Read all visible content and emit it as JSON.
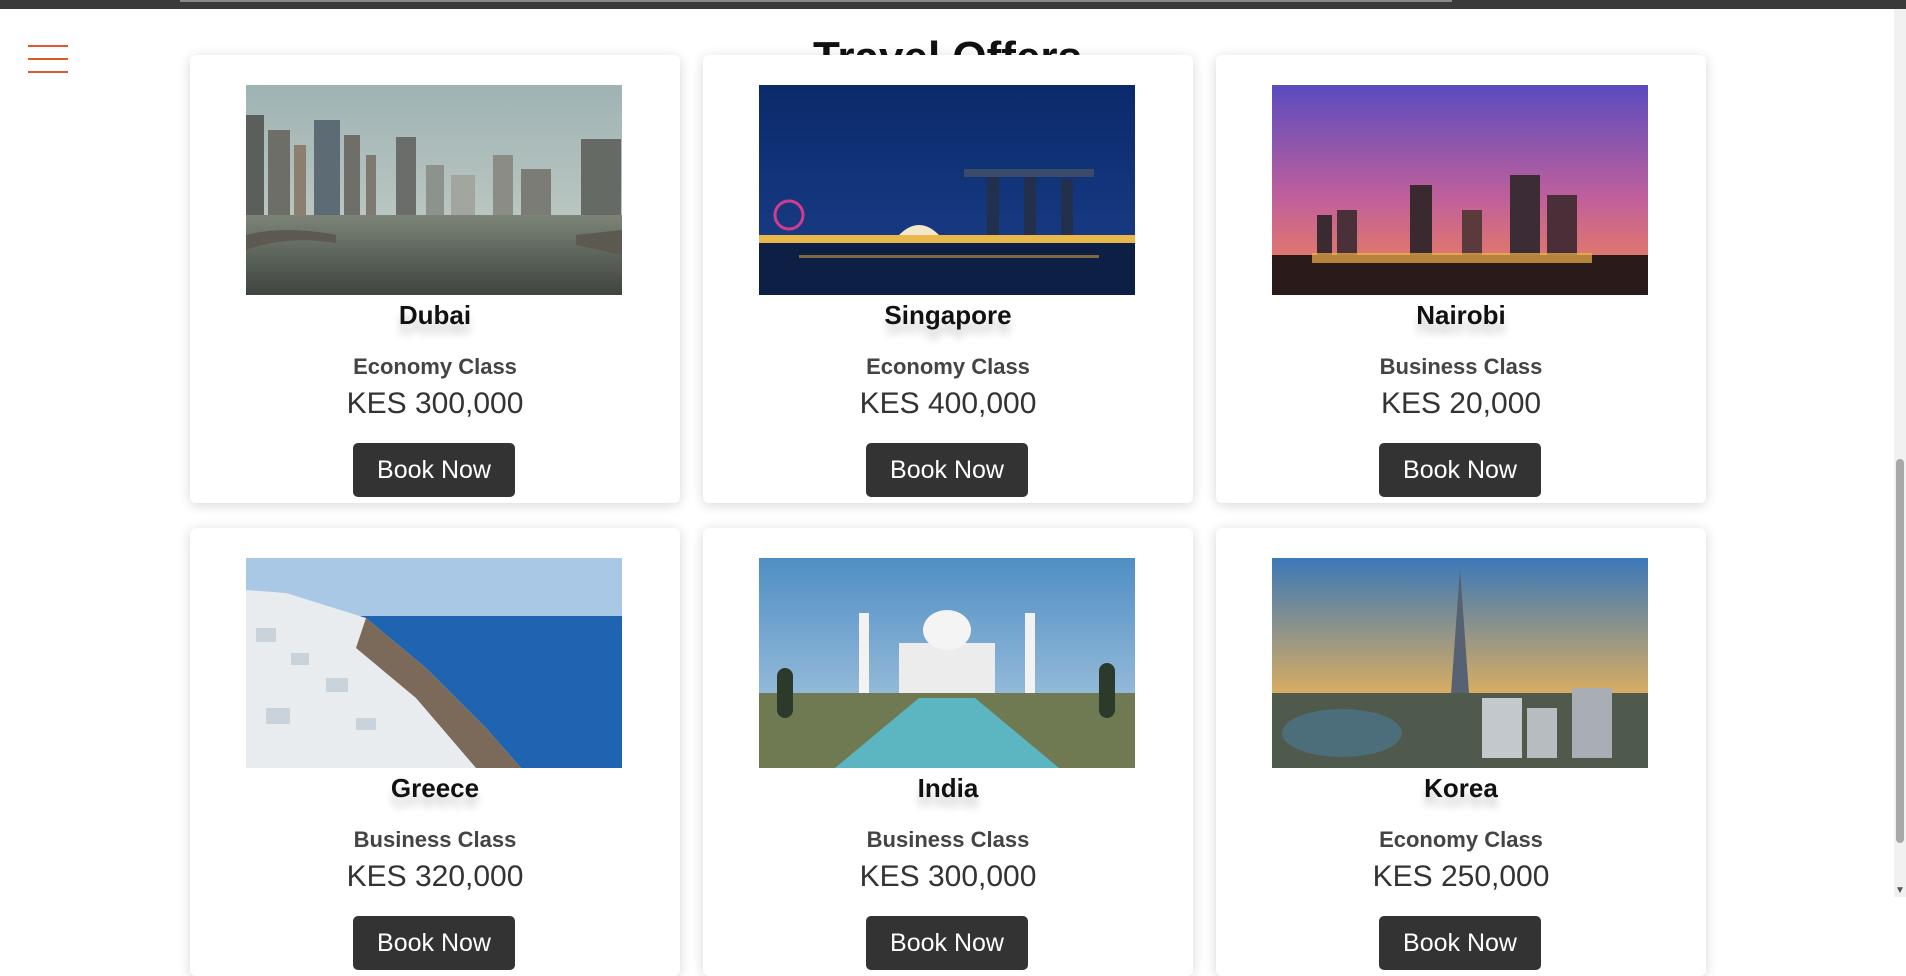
{
  "page": {
    "title": "Travel Offers"
  },
  "menu": {
    "icon": "hamburger-menu-icon"
  },
  "offers": [
    {
      "destination": "Dubai",
      "travel_class": "Economy Class",
      "price": "KES 300,000",
      "button": "Book Now"
    },
    {
      "destination": "Singapore",
      "travel_class": "Economy Class",
      "price": "KES 400,000",
      "button": "Book Now"
    },
    {
      "destination": "Nairobi",
      "travel_class": "Business Class",
      "price": "KES 20,000",
      "button": "Book Now"
    },
    {
      "destination": "Greece",
      "travel_class": "Business Class",
      "price": "KES 320,000",
      "button": "Book Now"
    },
    {
      "destination": "India",
      "travel_class": "Business Class",
      "price": "KES 300,000",
      "button": "Book Now"
    },
    {
      "destination": "Korea",
      "travel_class": "Economy Class",
      "price": "KES 250,000",
      "button": "Book Now"
    }
  ],
  "colors": {
    "accent": "#e4572e",
    "button": "#333333",
    "heading": "#111111",
    "class_text": "#444444"
  }
}
